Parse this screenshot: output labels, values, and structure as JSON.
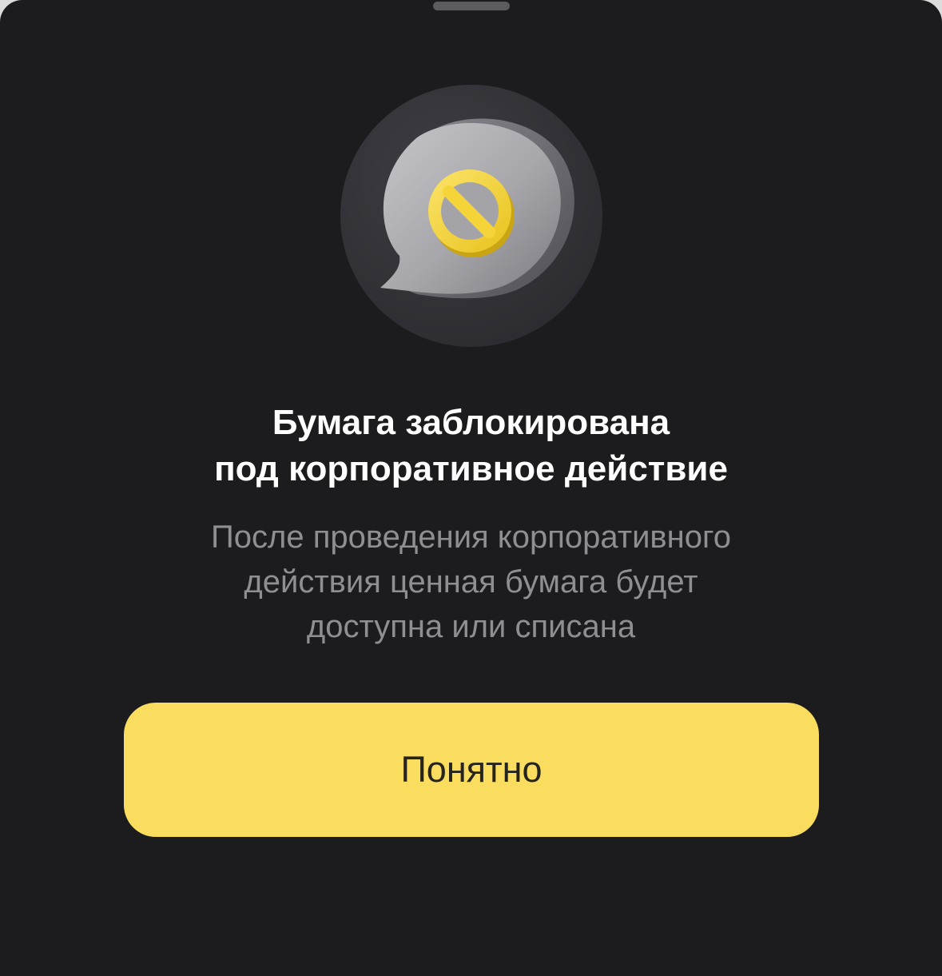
{
  "sheet": {
    "background_color": "#1c1c1e",
    "grabber": "drag-handle"
  },
  "illustration": {
    "icon": "blocked-message-icon",
    "bubble_color": "#a8a8ad",
    "symbol_color": "#f5d43a"
  },
  "title": {
    "line1": "Бумага заблокирована",
    "line2": "под корпоративное действие"
  },
  "subtitle": {
    "line1": "После проведения корпоративного",
    "line2": "действия ценная бумага будет",
    "line3": "доступна или списана"
  },
  "button": {
    "label": "Понятно",
    "color": "#fadc5e"
  }
}
